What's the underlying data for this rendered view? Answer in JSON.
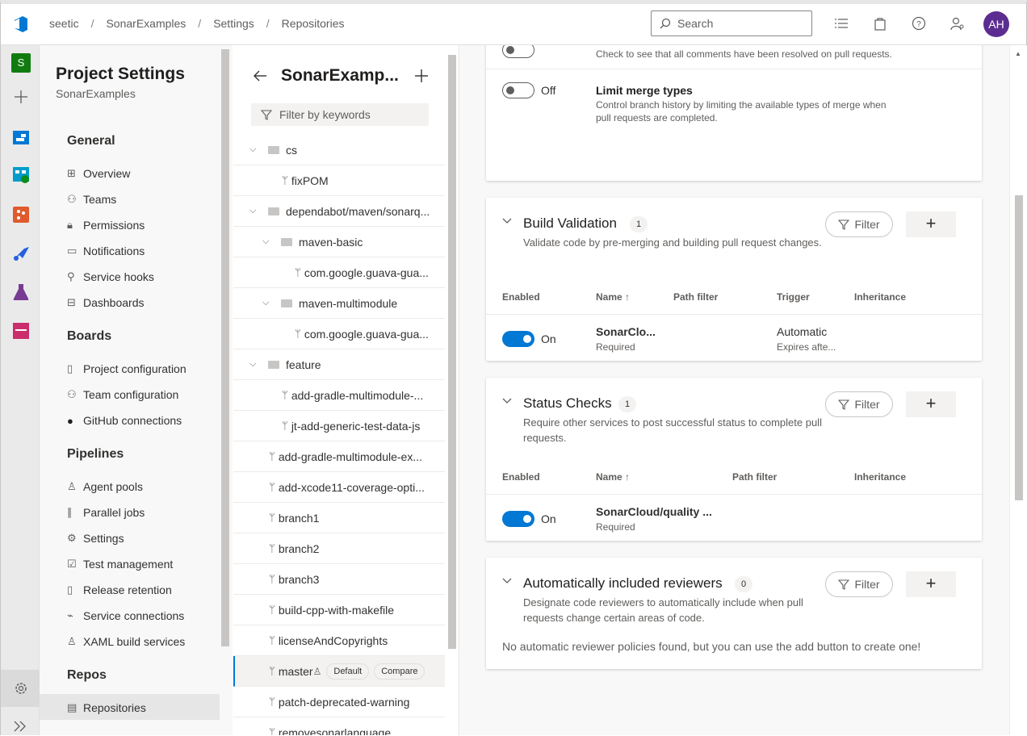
{
  "breadcrumb": [
    "seetic",
    "SonarExamples",
    "Settings",
    "Repositories"
  ],
  "search": {
    "placeholder": "Search"
  },
  "avatar": "AH",
  "rail": {
    "project_letter": "S"
  },
  "sidebar": {
    "title": "Project Settings",
    "subtitle": "SonarExamples",
    "general": {
      "label": "General",
      "items": [
        "Overview",
        "Teams",
        "Permissions",
        "Notifications",
        "Service hooks",
        "Dashboards"
      ]
    },
    "boards": {
      "label": "Boards",
      "items": [
        "Project configuration",
        "Team configuration",
        "GitHub connections"
      ]
    },
    "pipelines": {
      "label": "Pipelines",
      "items": [
        "Agent pools",
        "Parallel jobs",
        "Settings",
        "Test management",
        "Release retention",
        "Service connections",
        "XAML build services"
      ]
    },
    "repos": {
      "label": "Repos",
      "items": [
        "Repositories"
      ]
    }
  },
  "repo": {
    "title": "SonarExamp...",
    "filter_placeholder": "Filter by keywords",
    "tree": [
      {
        "label": "cs",
        "kind": "folder",
        "level": 0
      },
      {
        "label": "fixPOM",
        "kind": "branch",
        "level": 1
      },
      {
        "label": "dependabot/maven/sonarq...",
        "kind": "folder",
        "level": 0
      },
      {
        "label": "maven-basic",
        "kind": "folder",
        "level": 1
      },
      {
        "label": "com.google.guava-gua...",
        "kind": "branch",
        "level": 2
      },
      {
        "label": "maven-multimodule",
        "kind": "folder",
        "level": 1
      },
      {
        "label": "com.google.guava-gua...",
        "kind": "branch",
        "level": 2
      },
      {
        "label": "feature",
        "kind": "folder",
        "level": 0
      },
      {
        "label": "add-gradle-multimodule-...",
        "kind": "branch",
        "level": 1
      },
      {
        "label": "jt-add-generic-test-data-js",
        "kind": "branch",
        "level": 1
      },
      {
        "label": "add-gradle-multimodule-ex...",
        "kind": "branch",
        "level": 0
      },
      {
        "label": "add-xcode11-coverage-opti...",
        "kind": "branch",
        "level": 0
      },
      {
        "label": "branch1",
        "kind": "branch",
        "level": 0
      },
      {
        "label": "branch2",
        "kind": "branch",
        "level": 0
      },
      {
        "label": "branch3",
        "kind": "branch",
        "level": 0
      },
      {
        "label": "build-cpp-with-makefile",
        "kind": "branch",
        "level": 0
      },
      {
        "label": "licenseAndCopyrights",
        "kind": "branch",
        "level": 0
      },
      {
        "label": "master",
        "kind": "branch",
        "level": 0,
        "selected": true,
        "badges": [
          "Default",
          "Compare"
        ]
      },
      {
        "label": "patch-deprecated-warning",
        "kind": "branch",
        "level": 0
      },
      {
        "label": "removesonarlanguage",
        "kind": "branch",
        "level": 0
      }
    ]
  },
  "policies": {
    "comment_desc": "Check to see that all comments have been resolved on pull requests.",
    "merge": {
      "toggle": "Off",
      "title": "Limit merge types",
      "desc": "Control branch history by limiting the available types of merge when pull requests are completed."
    },
    "filter_label": "Filter",
    "build": {
      "title": "Build Validation",
      "count": "1",
      "desc": "Validate code by pre-merging and building pull request changes.",
      "headers": [
        "Enabled",
        "Name",
        "Path filter",
        "Trigger",
        "Inheritance"
      ],
      "row": {
        "toggle": "On",
        "name": "SonarClo...",
        "name_sub": "Required",
        "trigger": "Automatic",
        "trigger_sub": "Expires afte..."
      }
    },
    "status": {
      "title": "Status Checks",
      "count": "1",
      "desc": "Require other services to post successful status to complete pull requests.",
      "headers": [
        "Enabled",
        "Name",
        "Path filter",
        "Inheritance"
      ],
      "row": {
        "toggle": "On",
        "name": "SonarCloud/quality ...",
        "name_sub": "Required"
      }
    },
    "reviewers": {
      "title": "Automatically included reviewers",
      "count": "0",
      "desc": "Designate code reviewers to automatically include when pull requests change certain areas of code.",
      "empty": "No automatic reviewer policies found, but you can use the add button to create one!"
    }
  },
  "colors": {
    "accent": "#0078d4",
    "avatar": "#5c2d91"
  }
}
